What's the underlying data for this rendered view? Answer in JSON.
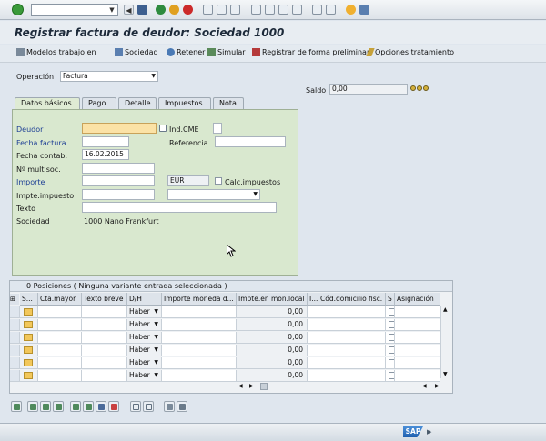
{
  "system_toolbar": {
    "command_field_value": "",
    "icons": [
      "enter-icon",
      "save-icon",
      "back-icon",
      "exit-icon",
      "cancel-icon",
      "print-icon",
      "find-icon",
      "find-next-icon",
      "first-page-icon",
      "previous-page-icon",
      "next-page-icon",
      "last-page-icon",
      "new-session-icon",
      "shortcut-icon",
      "help-icon",
      "customize-icon"
    ]
  },
  "title": "Registrar factura de deudor: Sociedad 1000",
  "app_toolbar": {
    "modelos": "Modelos trabajo en",
    "sociedad": "Sociedad",
    "retener": "Retener",
    "simular": "Simular",
    "registrar": "Registrar de forma preliminar",
    "opciones": "Opciones tratamiento"
  },
  "operacion": {
    "label": "Operación",
    "value": "Factura"
  },
  "saldo": {
    "label": "Saldo",
    "value": "0,00"
  },
  "tabs": [
    "Datos básicos",
    "Pago",
    "Detalle",
    "Impuestos",
    "Nota"
  ],
  "form": {
    "deudor": {
      "label": "Deudor",
      "value": ""
    },
    "ind_cme": {
      "label": "Ind.CME",
      "value": ""
    },
    "fecha_factura": {
      "label": "Fecha factura",
      "value": ""
    },
    "referencia": {
      "label": "Referencia",
      "value": ""
    },
    "fecha_contab": {
      "label": "Fecha contab.",
      "value": "16.02.2015"
    },
    "multisoc": {
      "label": "Nº multisoc.",
      "value": ""
    },
    "importe": {
      "label": "Importe",
      "value": "",
      "currency": "EUR"
    },
    "calc_impuestos": {
      "label": "Calc.impuestos",
      "checked": false
    },
    "impte_impuesto": {
      "label": "Impte.impuesto",
      "value": ""
    },
    "texto": {
      "label": "Texto",
      "value": ""
    },
    "sociedad": {
      "label": "Sociedad",
      "value": "1000 Nano Frankfurt"
    }
  },
  "grid": {
    "title": "0 Posiciones ( Ninguna variante entrada seleccionada )",
    "columns": [
      "S...",
      "Cta.mayor",
      "Texto breve",
      "D/H",
      "Importe moneda d...",
      "Impte.en mon.local",
      "I...",
      "Cód.domicilio fisc.",
      "S",
      "Asignación"
    ],
    "rows": [
      {
        "dh": "Haber",
        "amount": "0,00"
      },
      {
        "dh": "Haber",
        "amount": "0,00"
      },
      {
        "dh": "Haber",
        "amount": "0,00"
      },
      {
        "dh": "Haber",
        "amount": "0,00"
      },
      {
        "dh": "Haber",
        "amount": "0,00"
      },
      {
        "dh": "Haber",
        "amount": "0,00"
      }
    ]
  },
  "status_bar": {
    "logo": "SAP"
  }
}
